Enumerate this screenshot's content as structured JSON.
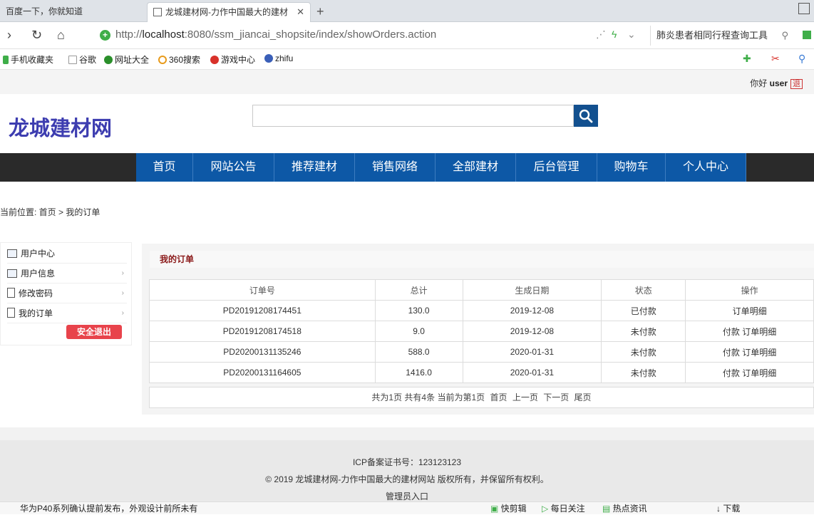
{
  "browser": {
    "tabs": [
      {
        "title": "百度一下，你就知道"
      },
      {
        "title": "龙城建材网-力作中国最大的建材"
      }
    ],
    "url_prefix": "http://",
    "url_host": "localhost",
    "url_rest": ":8080/ssm_jiancai_shopsite/index/showOrders.action",
    "search_text": "肺炎患者相同行程查询工具",
    "bookmarks": [
      "手机收藏夹",
      "谷歌",
      "网址大全",
      "360搜索",
      "游戏中心",
      "zhifu"
    ]
  },
  "site": {
    "greeting": "你好",
    "username": "user",
    "logout_short": "退",
    "logo": "龙城建材网",
    "nav": [
      "首页",
      "网站公告",
      "推荐建材",
      "销售网络",
      "全部建材",
      "后台管理",
      "购物车",
      "个人中心"
    ],
    "breadcrumb": "当前位置: 首页 > 我的订单",
    "sidebar": [
      "用户中心",
      "用户信息",
      "修改密码",
      "我的订单"
    ],
    "logout_button": "安全退出"
  },
  "orders": {
    "title": "我的订单",
    "columns": [
      "订单号",
      "总计",
      "生成日期",
      "状态",
      "操作"
    ],
    "rows": [
      {
        "id": "PD20191208174451",
        "total": "130.0",
        "date": "2019-12-08",
        "status": "已付款",
        "action": "订单明细"
      },
      {
        "id": "PD20191208174518",
        "total": "9.0",
        "date": "2019-12-08",
        "status": "未付款",
        "action": "付款 订单明细"
      },
      {
        "id": "PD20200131135246",
        "total": "588.0",
        "date": "2020-01-31",
        "status": "未付款",
        "action": "付款 订单明细"
      },
      {
        "id": "PD20200131164605",
        "total": "1416.0",
        "date": "2020-01-31",
        "status": "未付款",
        "action": "付款 订单明细"
      }
    ],
    "pager": {
      "summary": "共为1页 共有4条 当前为第1页",
      "first": "首页",
      "prev": "上一页",
      "next": "下一页",
      "last": "尾页"
    }
  },
  "footer": {
    "icp": "ICP备案证书号：123123123",
    "copyright": "© 2019 龙城建材网-力作中国最大的建材网站 版权所有，并保留所有权利。",
    "admin": "管理员入口"
  },
  "statusbar": {
    "news": "华为P40系列确认提前发布，外观设计前所未有",
    "items": [
      "快剪辑",
      "每日关注",
      "热点资讯",
      "下载"
    ]
  },
  "colors": {
    "nav_blue": "#0d58a6",
    "search_btn": "#12508f",
    "logo": "#3d3db0",
    "logout": "#e8434b",
    "order_title": "#8b1a1a"
  }
}
